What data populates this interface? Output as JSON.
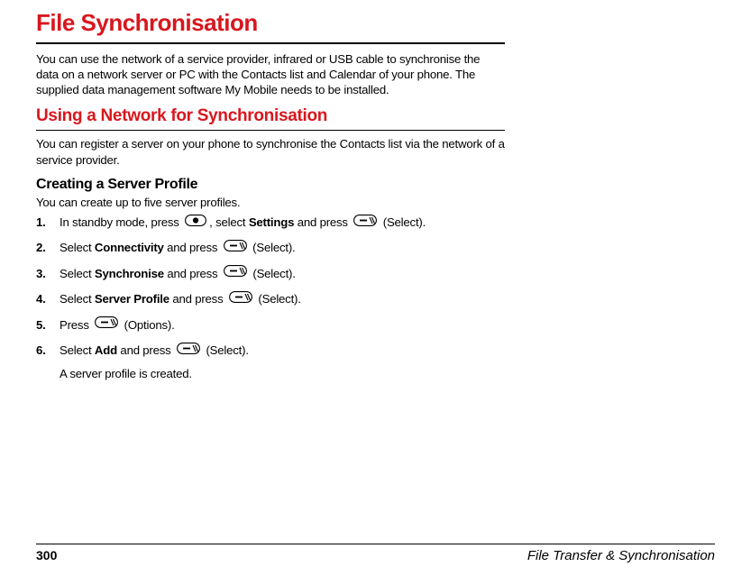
{
  "h1": "File Synchronisation",
  "intro": "You can use the network of a service provider, infrared or USB cable to synchronise the data on a network server or PC with the Contacts list and Calendar of your phone. The supplied data management software My Mobile needs to be installed.",
  "h2": "Using a Network for Synchronisation",
  "p2": "You can register a server on your phone to synchronise the Contacts list via the network of a service provider.",
  "h3": "Creating a Server Profile",
  "p3": "You can create up to five server profiles.",
  "steps": [
    {
      "num": "1.",
      "pre": "In standby mode, press ",
      "icon": "center",
      "mid": ", select ",
      "bold": "Settings",
      "post": " and press ",
      "icon2": "soft",
      "after": " (Select)."
    },
    {
      "num": "2.",
      "pre": "Select ",
      "bold": "Connectivity",
      "post": " and press ",
      "icon2": "soft",
      "after": " (Select)."
    },
    {
      "num": "3.",
      "pre": "Select ",
      "bold": "Synchronise",
      "post": " and press ",
      "icon2": "soft",
      "after": " (Select)."
    },
    {
      "num": "4.",
      "pre": "Select ",
      "bold": "Server Profile",
      "post": " and press ",
      "icon2": "soft",
      "after": " (Select)."
    },
    {
      "num": "5.",
      "pre": "Press ",
      "icon2": "soft",
      "after": " (Options)."
    },
    {
      "num": "6.",
      "pre": "Select ",
      "bold": "Add",
      "post": " and press ",
      "icon2": "soft",
      "after": " (Select)."
    }
  ],
  "tail": "A server profile is created.",
  "pageNum": "300",
  "sectionName": "File Transfer & Synchronisation"
}
